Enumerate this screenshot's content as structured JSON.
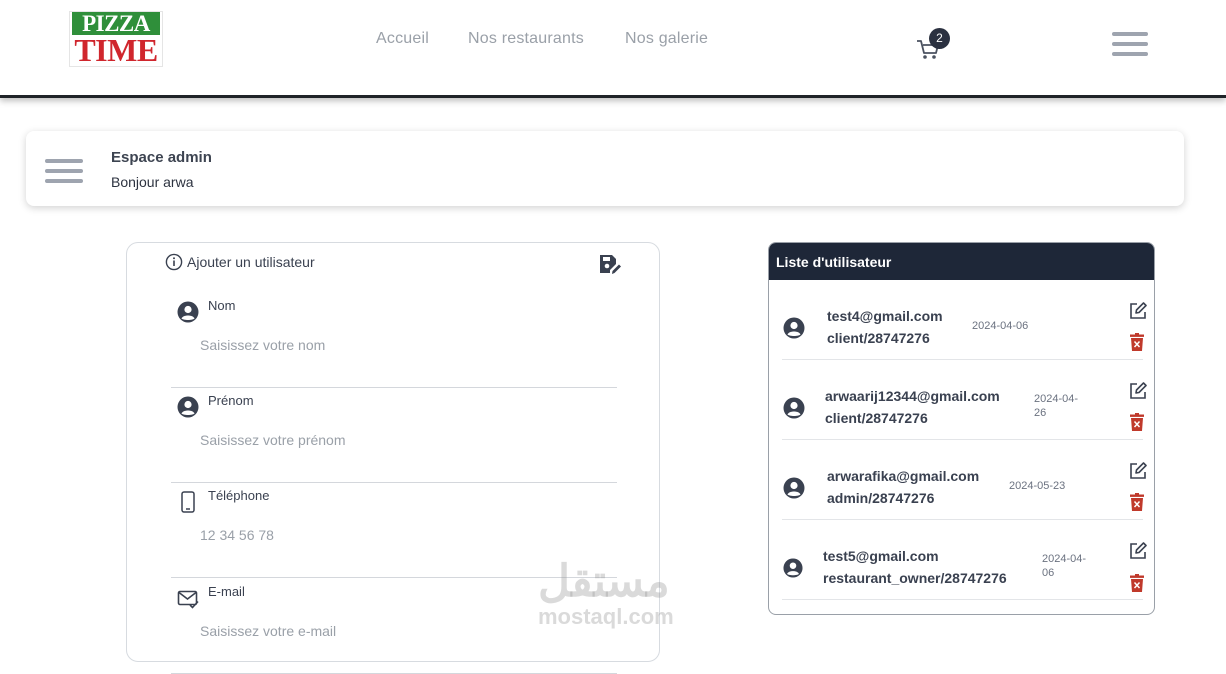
{
  "header": {
    "logo_top": "PIZZA",
    "logo_bottom": "TIME",
    "nav": [
      "Accueil",
      "Nos restaurants",
      "Nos galerie"
    ],
    "cart_count": "2"
  },
  "admin": {
    "title": "Espace admin",
    "greeting": "Bonjour arwa"
  },
  "form": {
    "title": "Ajouter un utilisateur",
    "fields": [
      {
        "label": "Nom",
        "placeholder": "Saisissez votre nom",
        "icon": "user-icon"
      },
      {
        "label": "Prénom",
        "placeholder": "Saisissez votre prénom",
        "icon": "user-icon"
      },
      {
        "label": "Téléphone",
        "placeholder": "12 34 56 78",
        "icon": "phone-icon"
      },
      {
        "label": "E-mail",
        "placeholder": "Saisissez votre e-mail",
        "icon": "mail-icon"
      }
    ]
  },
  "users": {
    "title": "Liste d'utilisateur",
    "rows": [
      {
        "email": "test4@gmail.com",
        "role": "client/28747276",
        "date": "2024-04-06"
      },
      {
        "email": "arwaarij12344@gmail.com",
        "role": "client/28747276",
        "date_l1": "2024-04-",
        "date_l2": "26"
      },
      {
        "email": "arwarafika@gmail.com",
        "role": "admin/28747276",
        "date": "2024-05-23"
      },
      {
        "email": "test5@gmail.com",
        "role": "restaurant_owner/28747276",
        "date_l1": "2024-04-",
        "date_l2": "06"
      }
    ]
  },
  "watermark": {
    "arabic": "مستقل",
    "latin": "mostaql.com"
  },
  "colors": {
    "accent_dark": "#1e2738",
    "delete_red": "#c0392b",
    "text_muted": "#9aa0a8"
  }
}
